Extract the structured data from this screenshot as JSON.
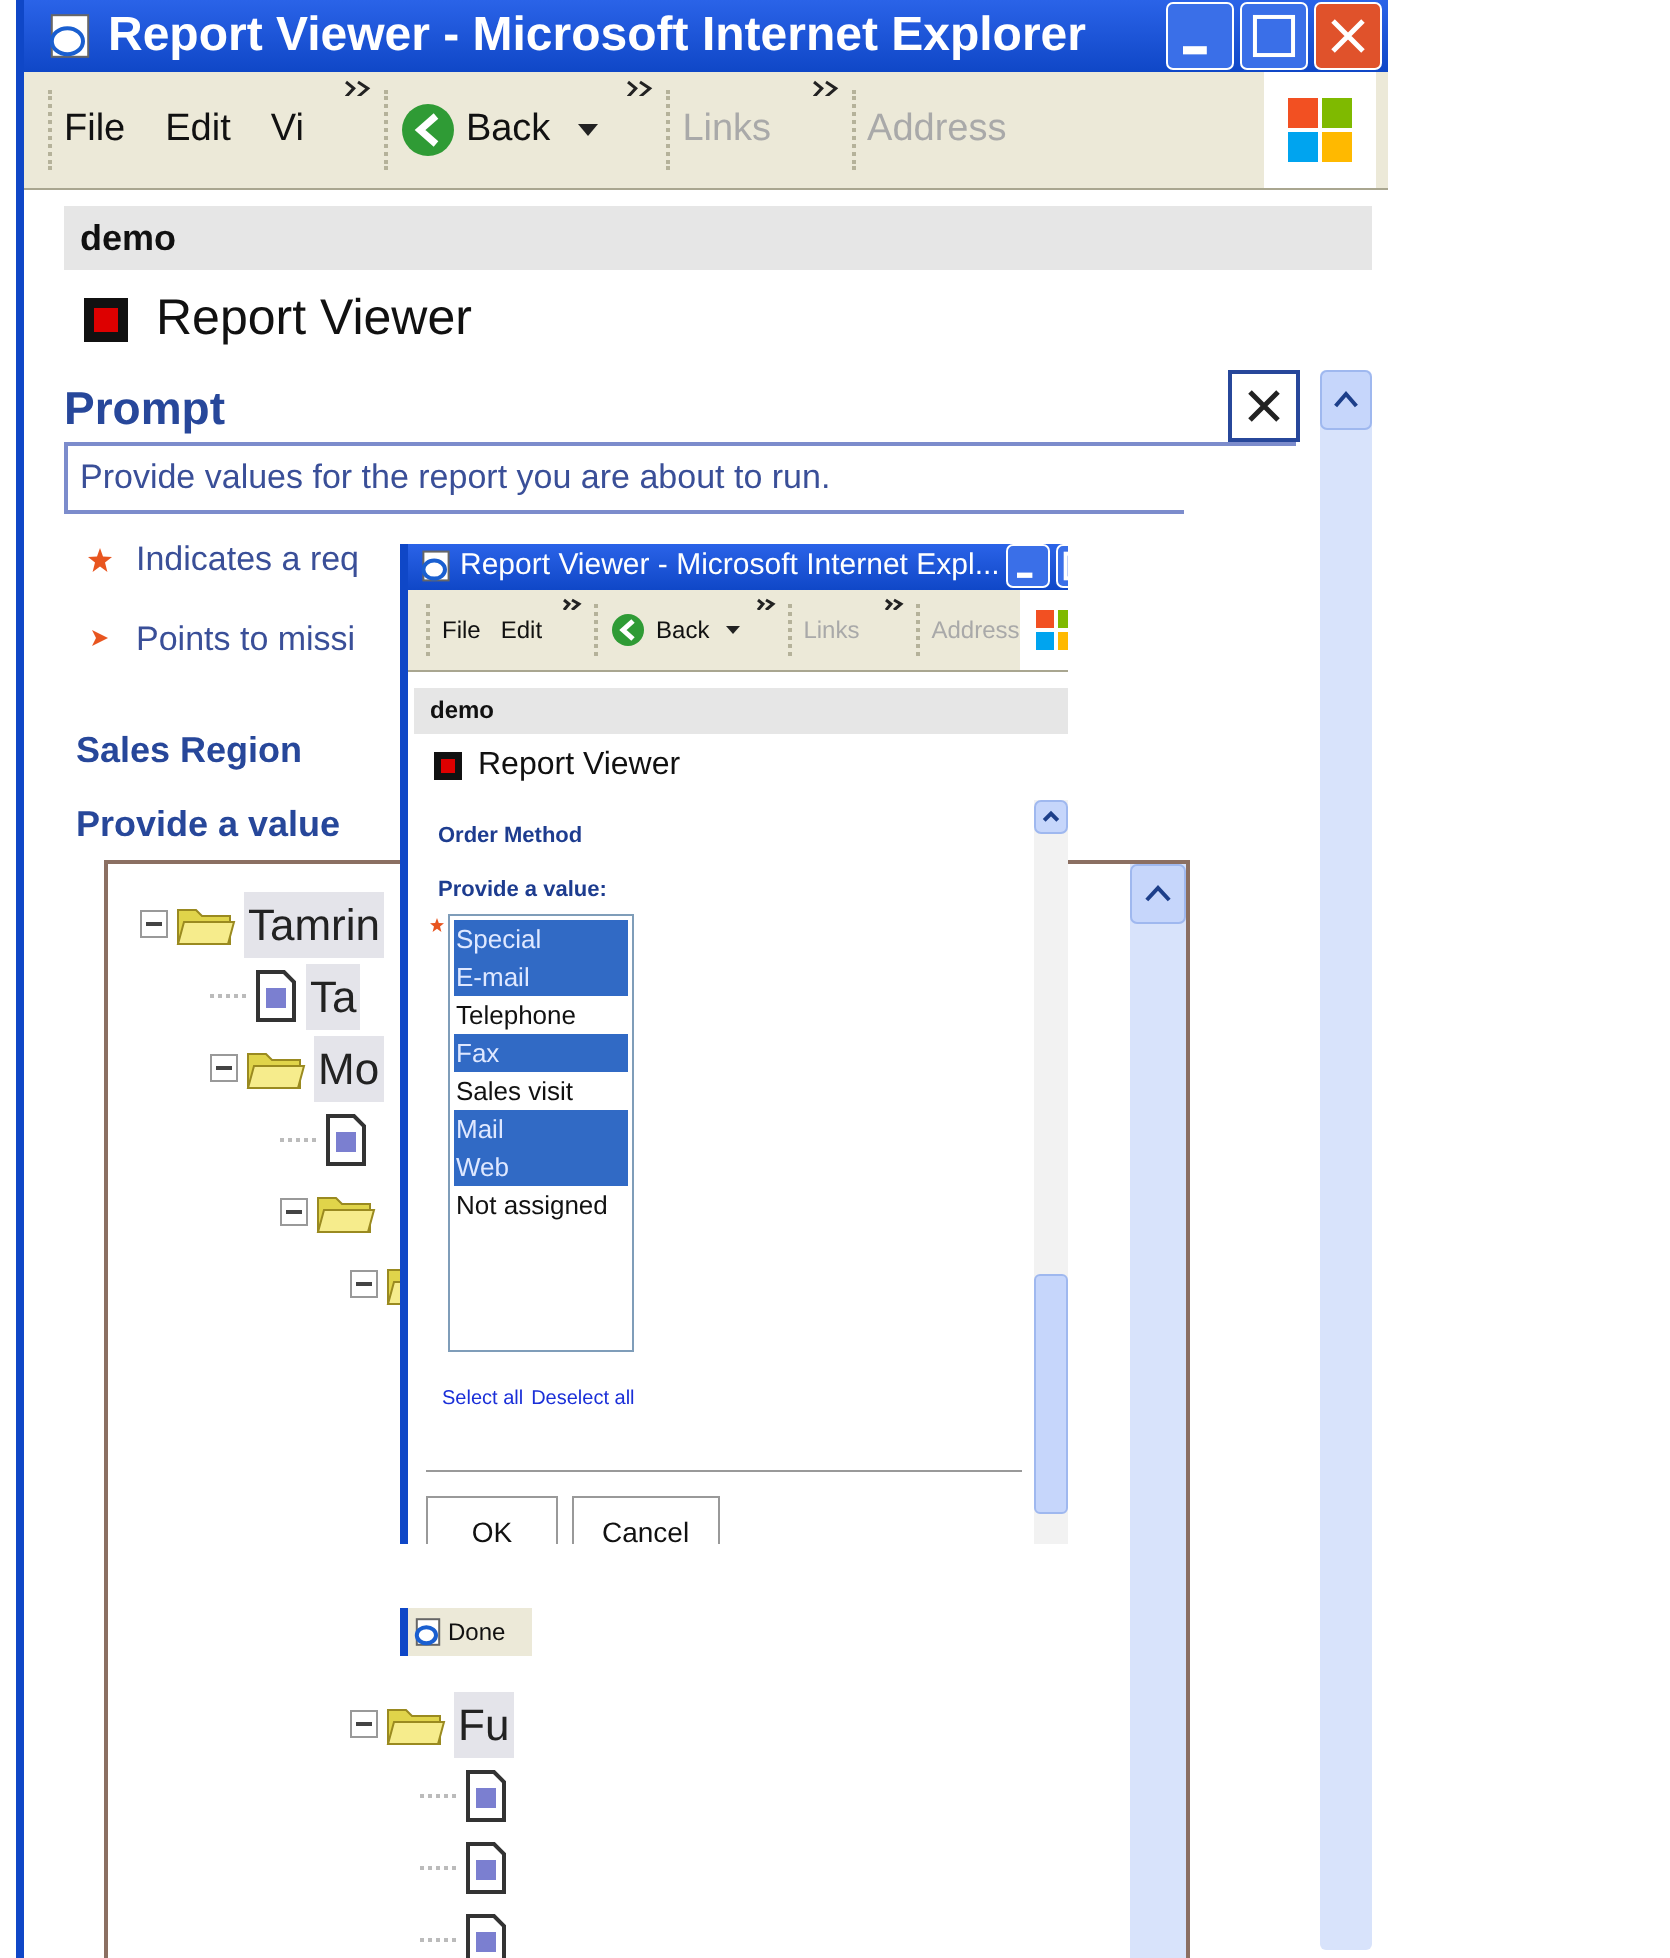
{
  "main_window": {
    "title": "Report Viewer - Microsoft Internet Explorer",
    "toolbar": {
      "menu": [
        "File",
        "Edit",
        "Vi"
      ],
      "back": "Back",
      "links": "Links",
      "address": "Address"
    },
    "header": "demo",
    "app_title": "Report Viewer",
    "prompt": {
      "title": "Prompt",
      "description": "Provide values for the report you are about to run.",
      "notes": [
        {
          "kind": "required",
          "text": "Indicates a req"
        },
        {
          "kind": "missing",
          "text": "Points to missi"
        }
      ]
    },
    "section": "Sales Region",
    "value_label": "Provide a value",
    "tree": [
      {
        "kind": "folder",
        "label": "Tamrin",
        "expanded": true,
        "children": [
          {
            "kind": "document",
            "label": "Ta"
          },
          {
            "kind": "folder",
            "label": "Mo",
            "expanded": true,
            "children": [
              {
                "kind": "document"
              },
              {
                "kind": "folder",
                "expanded": true,
                "children": [
                  {
                    "kind": "folder",
                    "expanded": true
                  },
                  {
                    "kind": "folder",
                    "label": "Fu",
                    "expanded": true,
                    "children": [
                      {
                        "kind": "document"
                      },
                      {
                        "kind": "document"
                      },
                      {
                        "kind": "document"
                      }
                    ]
                  }
                ]
              }
            ]
          }
        ]
      }
    ]
  },
  "dialog_window": {
    "title": "Report Viewer - Microsoft Internet Expl...",
    "toolbar": {
      "menu": [
        "File",
        "Edit"
      ],
      "back": "Back",
      "links": "Links",
      "address": "Address"
    },
    "header": "demo",
    "app_title": "Report Viewer",
    "field_label": "Order Method",
    "value_label": "Provide a value:",
    "options": [
      {
        "label": "Special",
        "selected": true
      },
      {
        "label": "E-mail",
        "selected": true
      },
      {
        "label": "Telephone",
        "selected": false
      },
      {
        "label": "Fax",
        "selected": true
      },
      {
        "label": "Sales visit",
        "selected": false
      },
      {
        "label": "Mail",
        "selected": true
      },
      {
        "label": "Web",
        "selected": true
      },
      {
        "label": "Not assigned",
        "selected": false
      }
    ],
    "links": [
      "Select all",
      "Deselect all"
    ],
    "buttons": [
      "OK",
      "Cancel"
    ],
    "status": "Done"
  }
}
